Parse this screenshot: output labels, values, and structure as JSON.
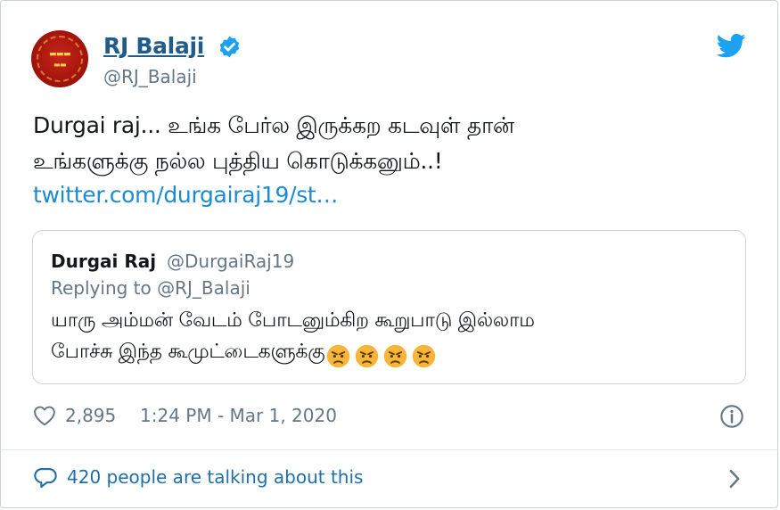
{
  "author": {
    "name": "RJ Balaji",
    "handle": "@RJ_Balaji",
    "verified": true,
    "avatar_icon": "avatar-logo-icon"
  },
  "tweet": {
    "line1": "Durgai raj... உங்க பேர்ல இருக்கற கடவுள் தான்",
    "line2": "உங்களுக்கு நல்ல புத்திய கொடுக்கனும்..!",
    "link": "twitter.com/durgairaj19/st…"
  },
  "quoted": {
    "name": "Durgai Raj",
    "handle": "@DurgaiRaj19",
    "replying_to": "Replying to @RJ_Balaji",
    "line1": "யாரு அம்மன் வேடம் போடனும்கிற கூறுபாடு இல்லாம",
    "line2": "போச்சு இந்த கூமுட்டைகளுக்கு",
    "emoji_count": 4,
    "emoji_icon": "angry-face-icon"
  },
  "meta": {
    "likes": "2,895",
    "timestamp": "1:24 PM - Mar 1, 2020"
  },
  "footer": {
    "talking": "420 people are talking about this"
  },
  "colors": {
    "link": "#1b8bd6",
    "twitter_blue": "#1da1f2",
    "muted": "#657786",
    "name_blue": "#1f5c8a"
  }
}
